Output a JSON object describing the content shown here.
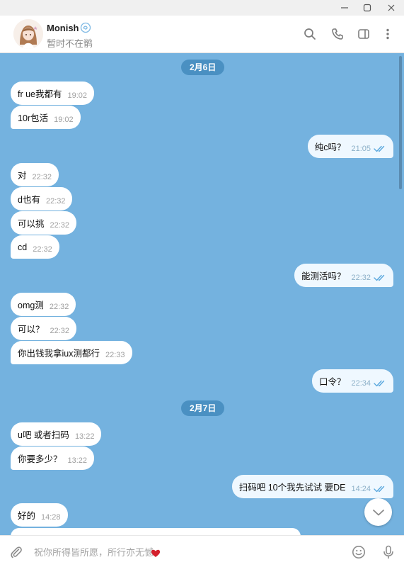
{
  "window": {
    "minimize_glyph": "—",
    "maximize_glyph": "☐",
    "close_glyph": "✕"
  },
  "header": {
    "contact_name": "Monish",
    "contact_status": "暂时不在鹡",
    "verified_icon": "cloud-emoji-icon",
    "actions": [
      "search-icon",
      "phone-icon",
      "sidebar-toggle-icon",
      "more-vertical-icon"
    ]
  },
  "chat": {
    "background_color": "#74b2df",
    "date_pills": [
      "2月6日",
      "2月7日"
    ],
    "messages": [
      {
        "side": "in",
        "text": "fr ue我都有",
        "time": "19:02"
      },
      {
        "side": "in",
        "text": "10r包活",
        "time": "19:02"
      },
      {
        "side": "out",
        "text": "纯c吗？",
        "time": "21:05",
        "status": "read"
      },
      {
        "side": "in",
        "text": "对",
        "time": "22:32"
      },
      {
        "side": "in",
        "text": "d也有",
        "time": "22:32"
      },
      {
        "side": "in",
        "text": "可以挑",
        "time": "22:32"
      },
      {
        "side": "in",
        "text": "cd",
        "time": "22:32"
      },
      {
        "side": "out",
        "text": "能测活吗？",
        "time": "22:32",
        "status": "read"
      },
      {
        "side": "in",
        "text": "omg测",
        "time": "22:32"
      },
      {
        "side": "in",
        "text": "可以？",
        "time": "22:32"
      },
      {
        "side": "in",
        "text": "你出钱我拿iux测都行",
        "time": "22:33"
      },
      {
        "side": "out",
        "text": "口令？",
        "time": "22:34",
        "status": "read"
      },
      {
        "side": "in",
        "text": "u吧 或者扫码",
        "time": "13:22"
      },
      {
        "side": "in",
        "text": "你要多少？",
        "time": "13:22"
      },
      {
        "side": "out",
        "text": "扫码吧  10个我先试试  要DE",
        "time": "14:24",
        "status": "read"
      },
      {
        "side": "in",
        "text": "好的",
        "time": "14:28"
      }
    ]
  },
  "composer": {
    "placeholder": "祝你所得皆所愿，所行亦无憾",
    "attach_icon": "paperclip-icon",
    "emoji_icon": "emoji-icon",
    "mic_icon": "microphone-icon"
  }
}
